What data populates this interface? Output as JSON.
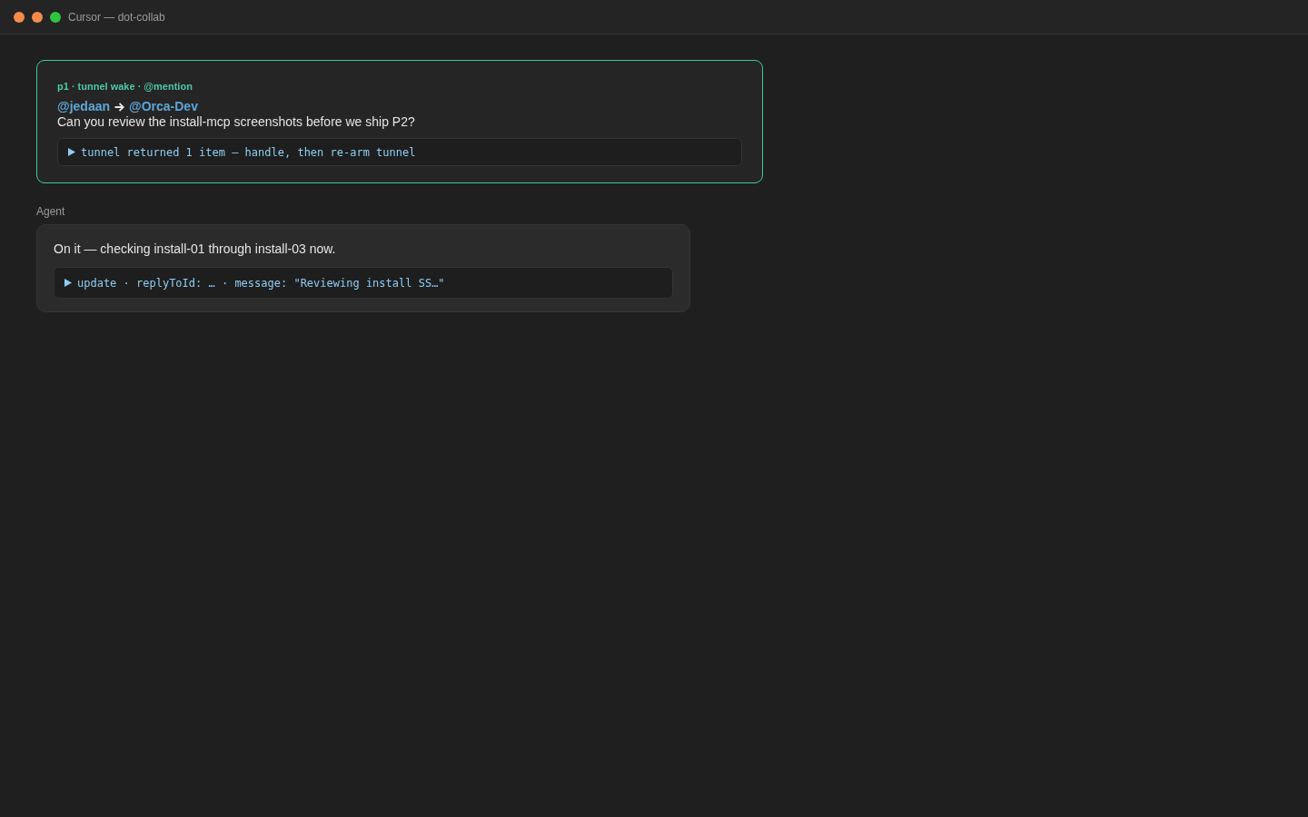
{
  "window": {
    "title": "Cursor — dot-collab"
  },
  "messages": [
    {
      "kind": "wake",
      "meta": "p1 · tunnel wake · @mention",
      "from": "@jedaan",
      "to": "@Orca-Dev",
      "text": "Can you review the install-mcp screenshots before we ship P2?",
      "tool": {
        "expanded": false,
        "text": "tunnel returned 1 item — handle, then re-arm tunnel"
      }
    },
    {
      "kind": "agent",
      "author": "Agent",
      "text": "On it — checking install-01 through install-03 now.",
      "tool": {
        "expanded": false,
        "text": "update · replyToId: … · message: \"Reviewing install SS…\""
      }
    }
  ]
}
